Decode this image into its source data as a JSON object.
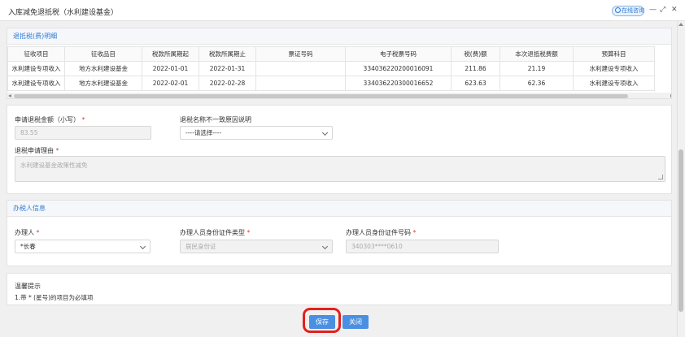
{
  "window": {
    "title": "入库减免退抵税（水利建设基金）",
    "online_consult_label": "在线咨询",
    "controls": {
      "minimize": "—",
      "maximize": "⤢",
      "close": "✕"
    }
  },
  "detail": {
    "heading": "退抵税(费)明细",
    "columns": [
      "征收项目",
      "征收品目",
      "税款所属期起",
      "税款所属期止",
      "票证号码",
      "电子税票号码",
      "税(费)额",
      "本次退抵税费额",
      "预算科目"
    ],
    "rows": [
      [
        "水利建设专项收入",
        "地方水利建设基金",
        "2022-01-01",
        "2022-01-31",
        "",
        "334036220200016091",
        "211.86",
        "21.19",
        "水利建设专项收入"
      ],
      [
        "水利建设专项收入",
        "地方水利建设基金",
        "2022-02-01",
        "2022-02-28",
        "",
        "334036220300016652",
        "623.63",
        "62.36",
        "水利建设专项收入"
      ]
    ]
  },
  "application": {
    "amount_label": "申请退税金额（小写）",
    "amount_value": "83.55",
    "name_reason_label": "退税名称不一致原因说明",
    "name_reason_value": "----请选择----",
    "reason_label": "退税申请理由",
    "reason_value": "水利建设基金政策性减免"
  },
  "handler": {
    "heading": "办税人信息",
    "name_label": "办理人",
    "name_value": "*长春",
    "id_type_label": "办理人员身份证件类型",
    "id_type_value": "居民身份证",
    "id_number_label": "办理人员身份证件号码",
    "id_number_value": "340303****0610"
  },
  "tips": {
    "title": "温馨提示",
    "line": "1.带 * (星号)的项目为必填项"
  },
  "actions": {
    "save_label": "保存",
    "close_label": "关闭"
  },
  "required_mark": "*",
  "colors": {
    "accent": "#4a90e2",
    "heading": "#2f7bd6",
    "required": "#e4393c",
    "highlight": "#e3211c"
  }
}
